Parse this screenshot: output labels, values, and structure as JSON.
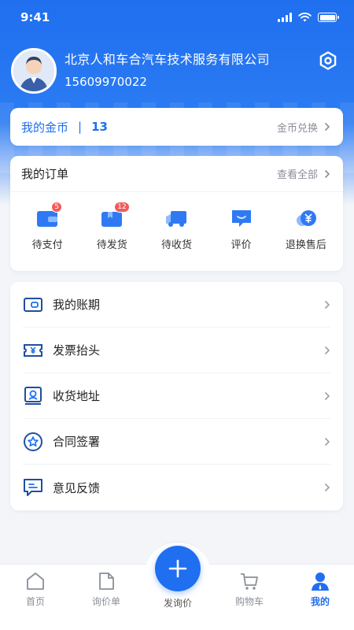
{
  "status_bar": {
    "time": "9:41",
    "battery_level": 1.0
  },
  "profile": {
    "company": "北京人和车合汽车技术服务有限公司",
    "phone": "15609970022",
    "icons": {
      "avatar": "user-avatar",
      "settings": "settings-hexagon-icon"
    }
  },
  "coins": {
    "label": "我的金币",
    "separator": "|",
    "count": "13",
    "exchange_label": "金币兑换"
  },
  "orders": {
    "title": "我的订单",
    "view_all": "查看全部",
    "items": [
      {
        "label": "待支付",
        "badge": "5",
        "icon": "wallet-icon"
      },
      {
        "label": "待发货",
        "badge": "12",
        "icon": "package-icon"
      },
      {
        "label": "待收货",
        "badge": "",
        "icon": "truck-icon"
      },
      {
        "label": "评价",
        "badge": "",
        "icon": "comment-icon"
      },
      {
        "label": "退换售后",
        "badge": "",
        "icon": "refund-icon"
      }
    ]
  },
  "menu": [
    {
      "label": "我的账期",
      "icon": "wallet-card-icon"
    },
    {
      "label": "发票抬头",
      "icon": "invoice-icon"
    },
    {
      "label": "收货地址",
      "icon": "address-icon"
    },
    {
      "label": "合同签署",
      "icon": "star-badge-icon"
    },
    {
      "label": "意见反馈",
      "icon": "feedback-icon"
    }
  ],
  "tabbar": {
    "items": [
      {
        "label": "首页",
        "icon": "home-icon"
      },
      {
        "label": "询价单",
        "icon": "document-icon"
      },
      {
        "label": "发询价",
        "icon": "plus-icon"
      },
      {
        "label": "购物车",
        "icon": "cart-icon"
      },
      {
        "label": "我的",
        "icon": "user-icon"
      }
    ],
    "active": "我的"
  },
  "colors": {
    "primary": "#1f6ff0",
    "badge": "#f45a5a",
    "background": "#f3f5f9",
    "muted_text": "#8b8f99"
  }
}
